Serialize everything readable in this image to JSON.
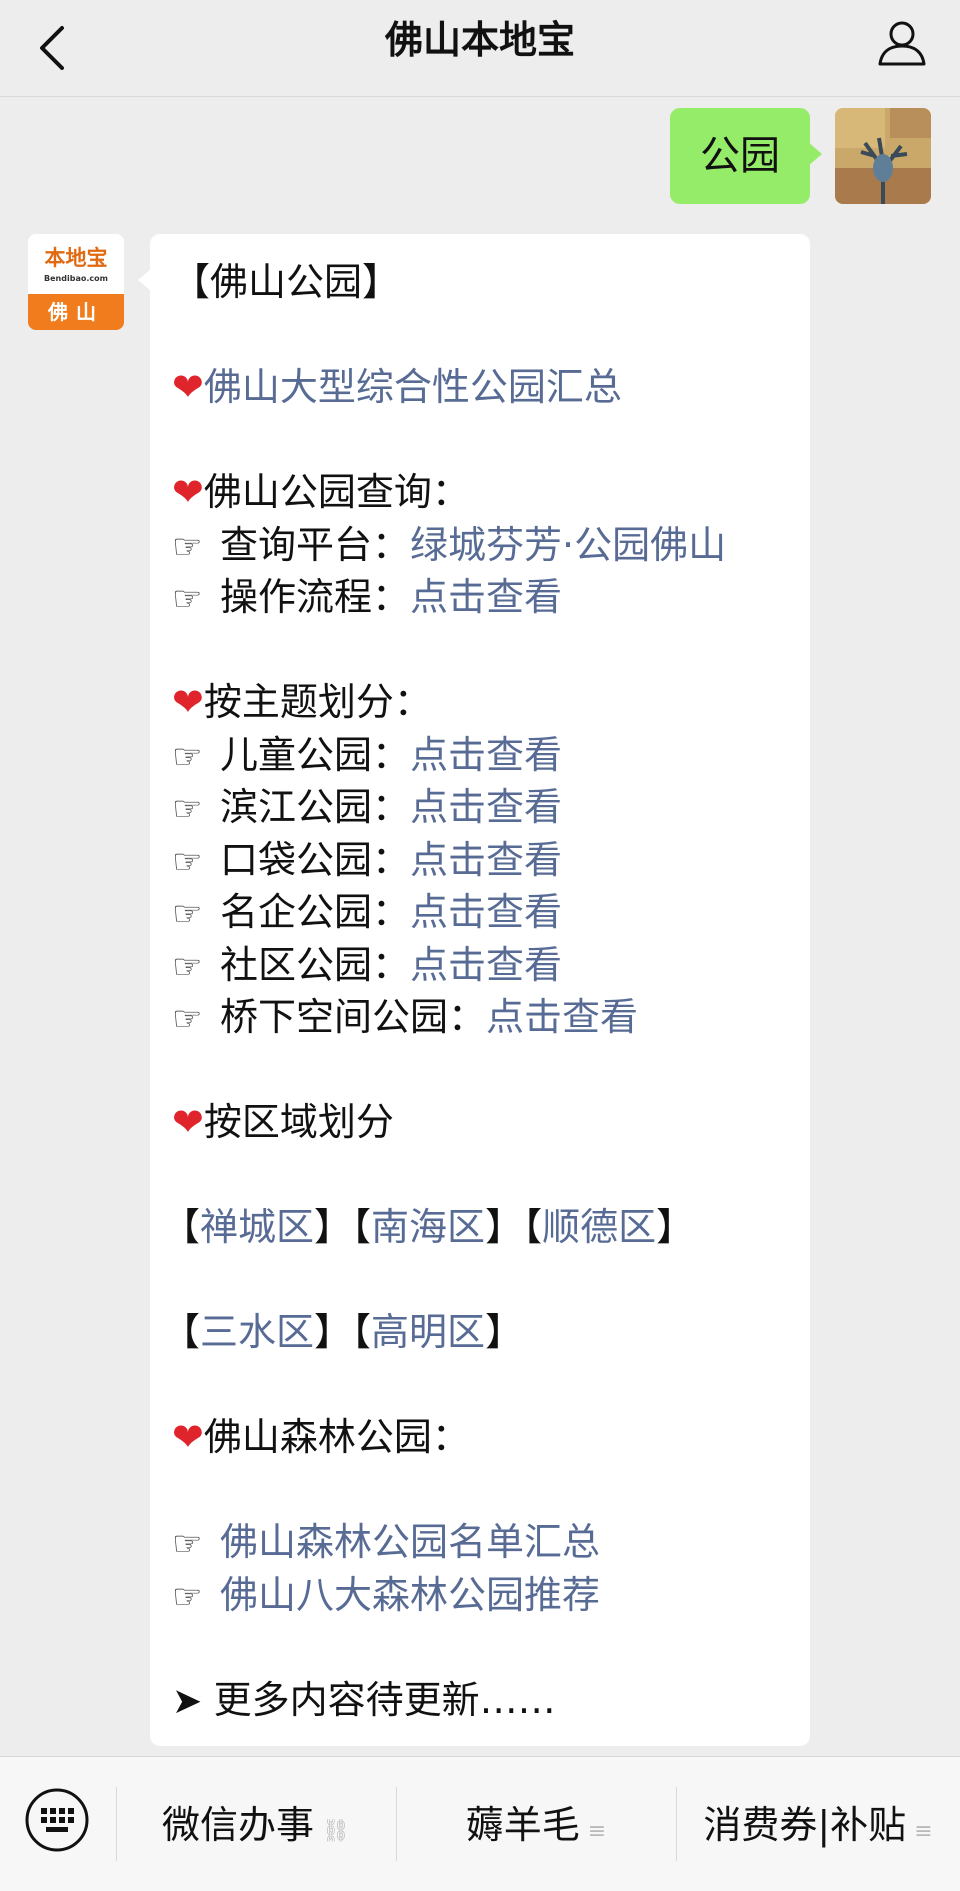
{
  "header": {
    "title": "佛山本地宝"
  },
  "outgoing": {
    "text": "公园"
  },
  "bot": {
    "logo_text": "本地宝",
    "logo_sub": "Bendibao.com",
    "city": "佛山"
  },
  "message": {
    "title": "【佛山公园】",
    "summary_link": "佛山大型综合性公园汇总",
    "query_heading": "佛山公园查询：",
    "platform_label": "查询平台：",
    "platform_link": "绿城芬芳·公园佛山",
    "process_label": "操作流程：",
    "click_view": "点击查看",
    "theme_heading": "按主题划分：",
    "theme_items": [
      "儿童公园：",
      "滨江公园：",
      "口袋公园：",
      "名企公园：",
      "社区公园：",
      "桥下空间公园："
    ],
    "district_heading": "按区域划分",
    "districts_row1": [
      "禅城区",
      "南海区",
      "顺德区"
    ],
    "districts_row2": [
      "三水区",
      "高明区"
    ],
    "forest_heading": "佛山森林公园：",
    "forest_links": [
      "佛山森林公园名单汇总",
      "佛山八大森林公园推荐"
    ],
    "more": "更多内容待更新……"
  },
  "menu": {
    "items": [
      "微信办事",
      "薅羊毛",
      "消费券|补贴"
    ],
    "icons": [
      "link-icon",
      "list-icon",
      "list-icon"
    ]
  },
  "colors": {
    "link": "#576b95",
    "bubble_out": "#95ec69",
    "heart": "#e0242c",
    "brand_orange": "#f07c1e"
  }
}
